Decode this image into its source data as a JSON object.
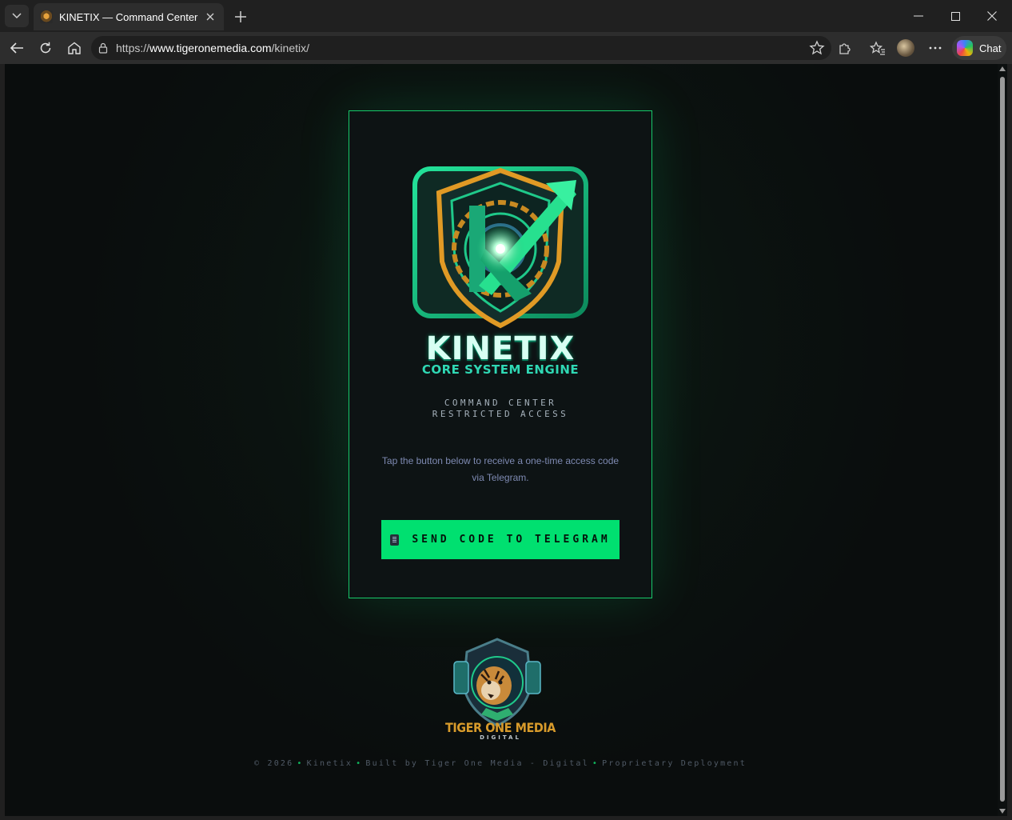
{
  "browser": {
    "tab_title": "KINETIX — Command Center",
    "url_scheme": "https://",
    "url_host": "www.tigeronemedia.com",
    "url_path": "/kinetix/",
    "chat_label": "Chat"
  },
  "login": {
    "brand_title": "KINETIX",
    "brand_subtitle": "CORE SYSTEM ENGINE",
    "heading_line1": "COMMAND CENTER",
    "heading_line2": "RESTRICTED ACCESS",
    "info_text": "Tap the button below to receive a one-time access code via Telegram.",
    "send_button_label": "SEND CODE TO TELEGRAM",
    "send_button_icon": "phone-icon"
  },
  "brand_footer": {
    "logo_title": "TIGER ONE MEDIA",
    "logo_subtitle": "DIGITAL",
    "copyright": "© 2026",
    "product": "Kinetix",
    "built_by": "Built by Tiger One Media - Digital",
    "deployment": "Proprietary Deployment"
  },
  "colors": {
    "accent": "#00e070",
    "card_border": "#17c96a",
    "background": "#0a0d0d"
  }
}
